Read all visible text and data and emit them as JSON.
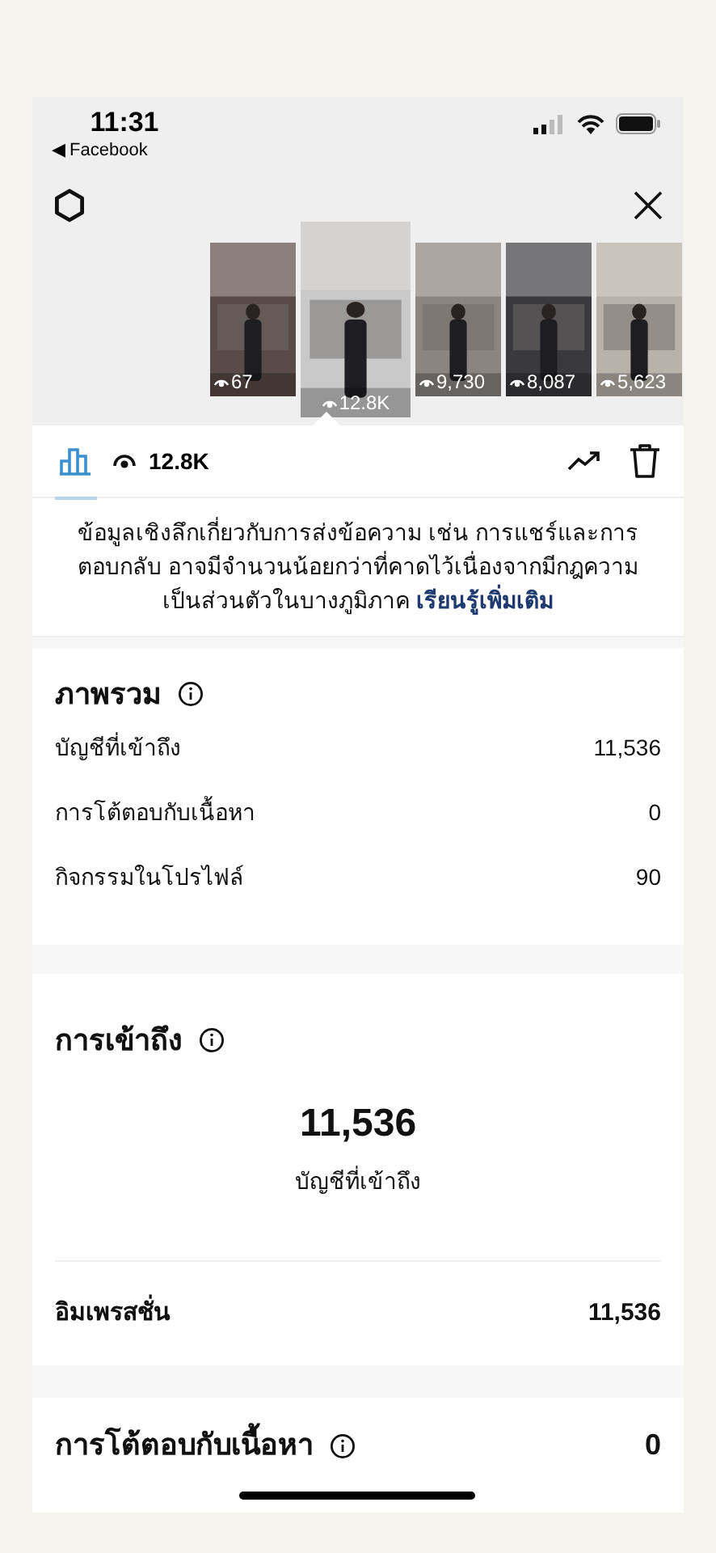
{
  "status_bar": {
    "time": "11:31",
    "back_app": "◀ Facebook"
  },
  "thumbnails": [
    {
      "views": "67",
      "selected": false,
      "color": "#5a4a48"
    },
    {
      "views": "12.8K",
      "selected": true,
      "color": "#c9c9c9"
    },
    {
      "views": "9,730",
      "selected": false,
      "color": "#8a8580"
    },
    {
      "views": "8,087",
      "selected": false,
      "color": "#3a3a3e"
    },
    {
      "views": "5,623",
      "selected": false,
      "color": "#b9b2a8"
    }
  ],
  "tabs": [
    {
      "kind": "insights",
      "selected": true
    },
    {
      "kind": "views",
      "label": "12.8K",
      "selected": false
    }
  ],
  "notice": {
    "text": "ข้อมูลเชิงลึกเกี่ยวกับการส่งข้อความ เช่น การแชร์และการตอบกลับ อาจมีจำนวนน้อยกว่าที่คาดไว้เนื่องจากมีกฎความเป็นส่วนตัวในบางภูมิภาค",
    "link": "เรียนรู้เพิ่มเติม"
  },
  "overview": {
    "title": "ภาพรวม",
    "rows": [
      {
        "label": "บัญชีที่เข้าถึง",
        "value": "11,536"
      },
      {
        "label": "การโต้ตอบกับเนื้อหา",
        "value": "0"
      },
      {
        "label": "กิจกรรมในโปรไฟล์",
        "value": "90"
      }
    ]
  },
  "reach": {
    "title": "การเข้าถึง",
    "total": "11,536",
    "caption": "บัญชีที่เข้าถึง",
    "rows": [
      {
        "label": "อิมเพรสชั่น",
        "value": "11,536"
      }
    ]
  },
  "interactions": {
    "title": "การโต้ตอบกับเนื้อหา",
    "value": "0"
  }
}
